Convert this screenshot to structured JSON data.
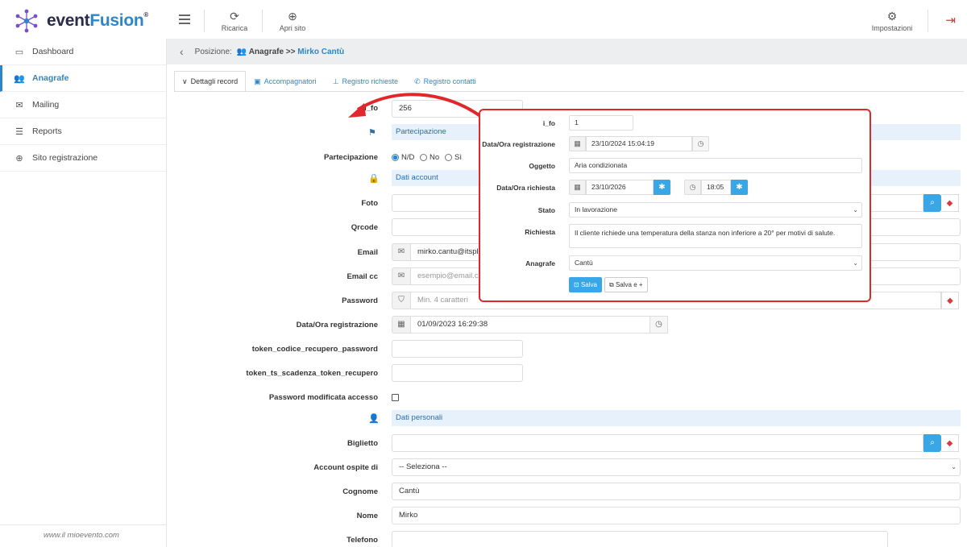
{
  "app": {
    "logo_main": "event",
    "logo_accent": "Fusion",
    "logo_mark": "®",
    "accent_color": "#2e86c9",
    "danger_color": "#e0282c"
  },
  "topbar": {
    "reload_label": "Ricarica",
    "open_site_label": "Apri sito",
    "settings_label": "Impostazioni"
  },
  "sidebar": {
    "items": [
      {
        "label": "Dashboard",
        "icon": "monitor-icon"
      },
      {
        "label": "Anagrafe",
        "icon": "users-icon",
        "active": true
      },
      {
        "label": "Mailing",
        "icon": "envelope-icon"
      },
      {
        "label": "Reports",
        "icon": "list-icon"
      },
      {
        "label": "Sito registrazione",
        "icon": "globe-icon"
      }
    ],
    "footer": "www.il mioevento.com"
  },
  "breadcrumb": {
    "prefix": "Posizione:",
    "section": "Anagrafe >>",
    "name": "Mirko Cantù"
  },
  "tabs": [
    {
      "label": "Dettagli record",
      "active": true
    },
    {
      "label": "Accompagnatori"
    },
    {
      "label": "Registro richieste"
    },
    {
      "label": "Registro contatti"
    }
  ],
  "form": {
    "ifo_label": "i_fo",
    "ifo_value": "256",
    "section_partecipazione": "Partecipazione",
    "partecipazione_label": "Partecipazione",
    "radio_options": [
      "N/D",
      "No",
      "Sì"
    ],
    "radio_selected": "N/D",
    "section_account": "Dati account",
    "foto_label": "Foto",
    "qrcode_label": "Qrcode",
    "email_label": "Email",
    "email_value": "mirko.cantu@itsplanet",
    "emailcc_label": "Email cc",
    "emailcc_placeholder": "esempio@email.com",
    "password_label": "Password",
    "password_placeholder": "Min. 4 caratteri",
    "dataora_label": "Data/Ora registrazione",
    "dataora_value": "01/09/2023 16:29:38",
    "token_codice_label": "token_codice_recupero_password",
    "token_ts_label": "token_ts_scadenza_token_recupero",
    "pwd_mod_label": "Password modificata accesso",
    "section_personali": "Dati personali",
    "biglietto_label": "Biglietto",
    "ospite_label": "Account ospite di",
    "ospite_value": "-- Seleziona --",
    "cognome_label": "Cognome",
    "cognome_value": "Cantù",
    "nome_label": "Nome",
    "nome_value": "Mirko",
    "telefono_label": "Telefono"
  },
  "modal": {
    "ifo_label": "i_fo",
    "ifo_value": "1",
    "dataora_label": "Data/Ora registrazione",
    "dataora_value": "23/10/2024 15:04:19",
    "oggetto_label": "Oggetto",
    "oggetto_value": "Aria condizionata",
    "richiesta_dt_label": "Data/Ora richiesta",
    "richiesta_date": "23/10/2026",
    "richiesta_time": "18:05",
    "stato_label": "Stato",
    "stato_value": "In lavorazione",
    "richiesta_label": "Richiesta",
    "richiesta_value": "Il cliente richiede una temperatura della stanza non inferiore a 20° per motivi di salute.",
    "anagrafe_label": "Anagrafe",
    "anagrafe_value": "Cantù",
    "save_label": "Salva",
    "save_new_label": "Salva e +"
  }
}
